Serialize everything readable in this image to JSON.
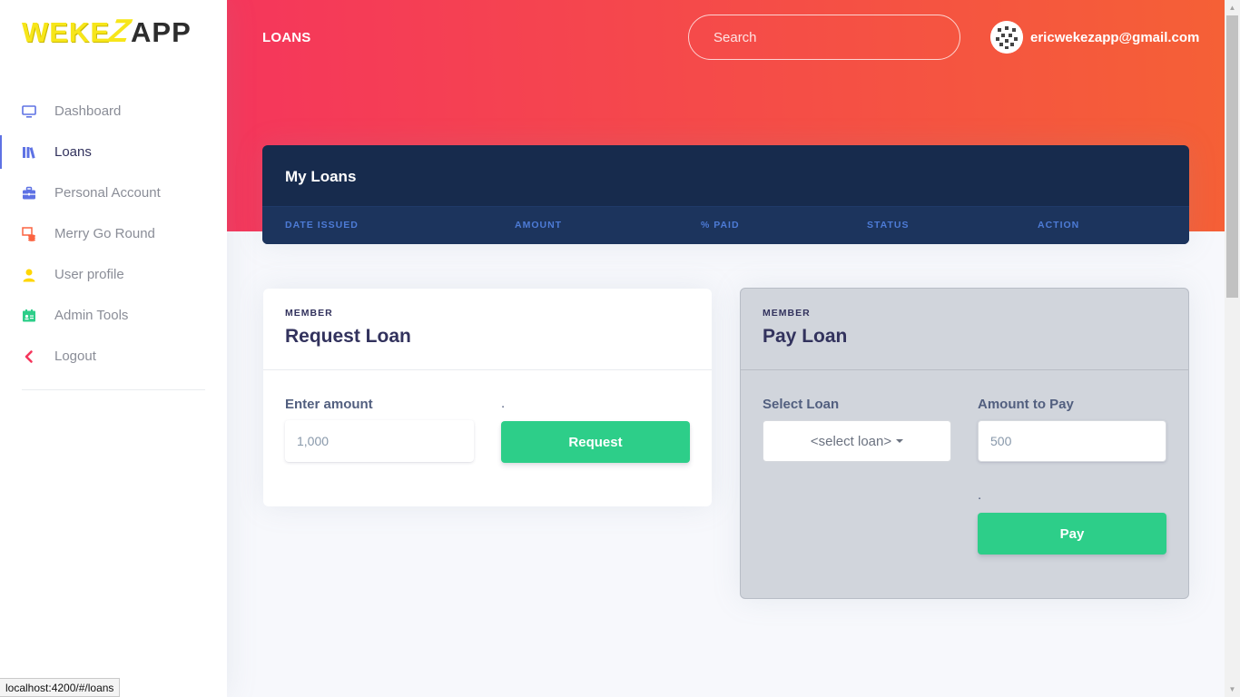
{
  "brand": {
    "part1": "WEKE",
    "part2": "Z",
    "part3": "APP"
  },
  "sidebar": {
    "items": [
      {
        "label": "Dashboard",
        "icon": "monitor-icon",
        "color": "#5e72e4"
      },
      {
        "label": "Loans",
        "icon": "books-icon",
        "color": "#5e72e4",
        "active": true
      },
      {
        "label": "Personal Account",
        "icon": "briefcase-icon",
        "color": "#5e72e4"
      },
      {
        "label": "Merry Go Round",
        "icon": "coins-icon",
        "color": "#fb6340"
      },
      {
        "label": "User profile",
        "icon": "user-icon",
        "color": "#ffd600"
      },
      {
        "label": "Admin Tools",
        "icon": "id-card-icon",
        "color": "#2dce89"
      },
      {
        "label": "Logout",
        "icon": "chevron-left-icon",
        "color": "#f5365c"
      }
    ]
  },
  "header": {
    "title": "LOANS",
    "search_placeholder": "Search",
    "user_email": "ericwekezapp@gmail.com"
  },
  "my_loans": {
    "title": "My Loans",
    "columns": [
      "Date Issued",
      "Amount",
      "% Paid",
      "Status",
      "Action"
    ]
  },
  "request_loan": {
    "kicker": "MEMBER",
    "title": "Request Loan",
    "amount_label": "Enter amount",
    "amount_placeholder": "1,000",
    "dot": ".",
    "button": "Request"
  },
  "pay_loan": {
    "kicker": "MEMBER",
    "title": "Pay Loan",
    "select_label": "Select Loan",
    "select_value": "<select loan>",
    "amount_label": "Amount to Pay",
    "amount_placeholder": "500",
    "dot": ".",
    "button": "Pay"
  },
  "statusbar": {
    "url": "localhost:4200/#/loans"
  },
  "colors": {
    "gradient_start": "#f5365c",
    "gradient_end": "#f56036",
    "navy": "#172b4d",
    "green": "#2dce89",
    "primary": "#5e72e4"
  }
}
